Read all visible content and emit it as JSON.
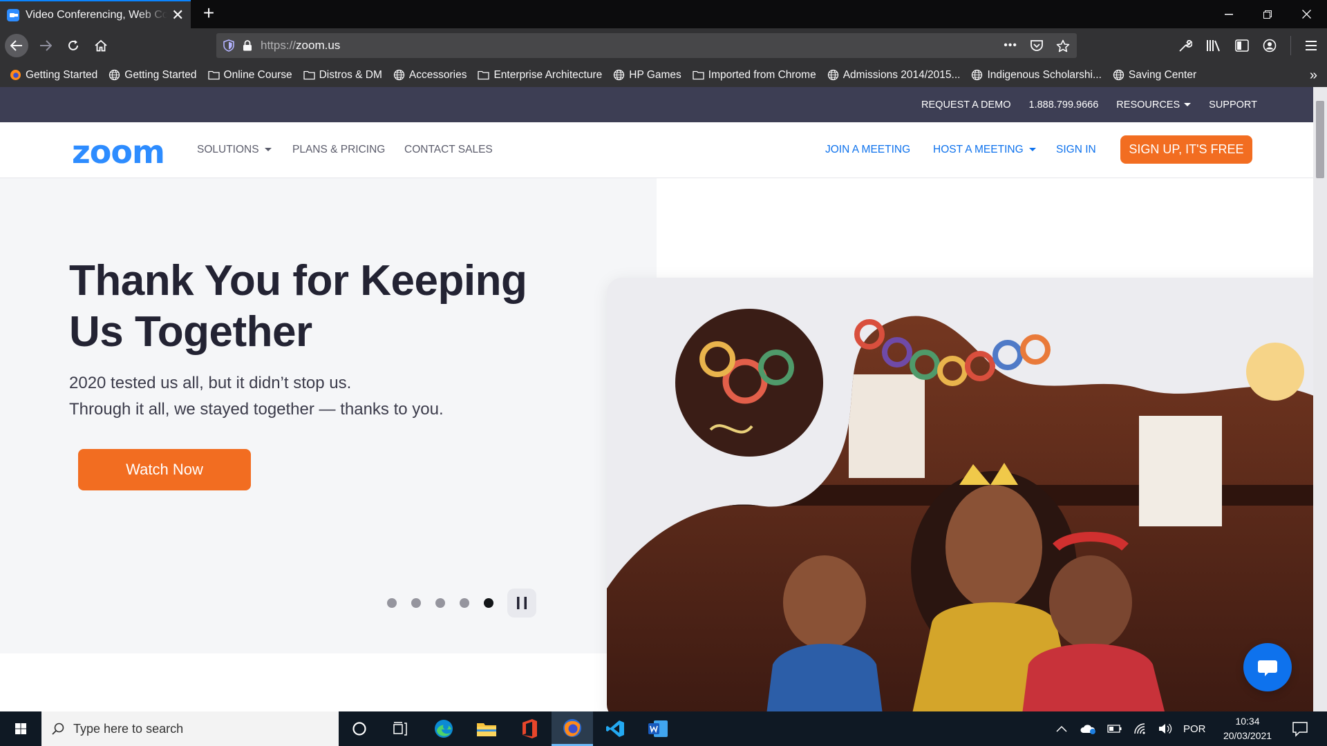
{
  "browser": {
    "tab": {
      "title": "Video Conferencing, Web Conferencing, Webinars, Screen Sharing",
      "close_label": "✕"
    },
    "new_tab_label": "+",
    "window_controls": {
      "minimize": "—",
      "restore": "❐",
      "close": "✕"
    },
    "url": {
      "scheme": "https://",
      "host": "zoom.us"
    },
    "url_actions": {
      "more": "•••"
    },
    "bookmarks": [
      {
        "label": "Getting Started",
        "icon": "firefox-icon"
      },
      {
        "label": "Getting Started",
        "icon": "globe-icon"
      },
      {
        "label": "Online Course",
        "icon": "folder-icon"
      },
      {
        "label": "Distros & DM",
        "icon": "folder-icon"
      },
      {
        "label": "Accessories",
        "icon": "globe-icon"
      },
      {
        "label": "Enterprise Architecture",
        "icon": "folder-icon"
      },
      {
        "label": "HP Games",
        "icon": "globe-icon"
      },
      {
        "label": "Imported from Chrome",
        "icon": "folder-icon"
      },
      {
        "label": "Admissions 2014/2015...",
        "icon": "globe-icon"
      },
      {
        "label": "Indigenous Scholarshi...",
        "icon": "globe-icon"
      },
      {
        "label": "Saving Center",
        "icon": "globe-icon"
      }
    ],
    "bookmarks_more": "»"
  },
  "site": {
    "topstrip": {
      "request_demo": "REQUEST A DEMO",
      "phone": "1.888.799.9666",
      "resources": "RESOURCES",
      "support": "SUPPORT"
    },
    "logo": "zoom",
    "nav": {
      "solutions": "SOLUTIONS",
      "plans": "PLANS & PRICING",
      "contact": "CONTACT SALES",
      "join": "JOIN A MEETING",
      "host": "HOST A MEETING",
      "sign_in": "SIGN IN",
      "sign_up": "SIGN UP, IT'S FREE"
    },
    "hero": {
      "title": "Thank You for Keeping Us Together",
      "subtitle_line1": "2020 tested us all, but it didn’t stop us.",
      "subtitle_line2": "Through it all, we stayed together — thanks to you.",
      "cta": "Watch Now",
      "carousel": {
        "total_slides": 5,
        "active_slide": 5
      }
    },
    "colors": {
      "brand_blue": "#2d8cff",
      "link_blue": "#0e72ed",
      "cta_orange": "#f26d21",
      "topstrip_bg": "#3d3e54",
      "hero_bg": "#f5f6f8"
    }
  },
  "taskbar": {
    "search_placeholder": "Type here to search",
    "apps": [
      "cortana-icon",
      "task-view-icon",
      "edge-icon",
      "file-explorer-icon",
      "office-icon",
      "firefox-icon",
      "vscode-icon",
      "word-icon"
    ],
    "language": "POR",
    "time": "10:34",
    "date": "20/03/2021"
  }
}
